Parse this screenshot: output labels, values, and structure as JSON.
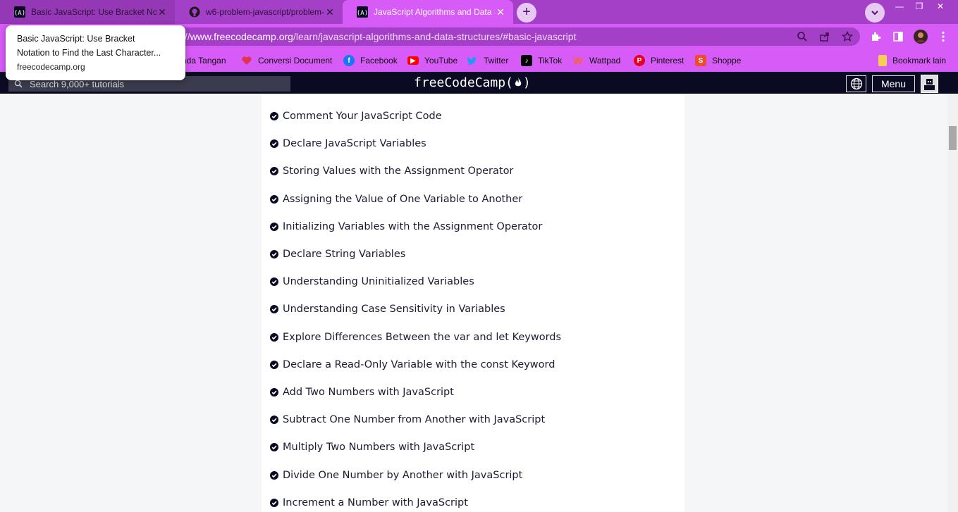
{
  "browser": {
    "tabs": [
      {
        "title": "Basic JavaScript: Use Bracket Not",
        "icon": "freecodecamp-icon"
      },
      {
        "title": "w6-problem-javascript/problem-",
        "icon": "github-icon"
      },
      {
        "title": "JavaScript Algorithms and Data S",
        "icon": "freecodecamp-icon"
      }
    ],
    "url_prefix": "://",
    "url_host": "www.freecodecamp.org",
    "url_path": "/learn/javascript-algorithms-and-data-structures/#basic-javascript",
    "hovercard": {
      "title_line1": "Basic JavaScript: Use Bracket",
      "title_line2": "Notation to Find the Last Character...",
      "domain": "freecodecamp.org"
    },
    "bookmarks": [
      {
        "label": "nda Tangan"
      },
      {
        "label": "Conversi Document",
        "color": "#e0344e"
      },
      {
        "label": "Facebook",
        "color": "#1877f2"
      },
      {
        "label": "YouTube",
        "color": "#ff0000"
      },
      {
        "label": "Twitter",
        "color": "#1d9bf0"
      },
      {
        "label": "TikTok",
        "color": "#000000"
      },
      {
        "label": "Wattpad",
        "color": "#ff6122"
      },
      {
        "label": "Pinterest",
        "color": "#e60023"
      },
      {
        "label": "Shoppe",
        "color": "#ee4d2d"
      }
    ],
    "other_bookmarks": "Bookmark lain"
  },
  "fcc": {
    "search_placeholder": "Search 9,000+ tutorials",
    "brand": "freeCodeCamp(",
    "brand_close": ")",
    "menu_label": "Menu"
  },
  "lessons": [
    "Comment Your JavaScript Code",
    "Declare JavaScript Variables",
    "Storing Values with the Assignment Operator",
    "Assigning the Value of One Variable to Another",
    "Initializing Variables with the Assignment Operator",
    "Declare String Variables",
    "Understanding Uninitialized Variables",
    "Understanding Case Sensitivity in Variables",
    "Explore Differences Between the var and let Keywords",
    "Declare a Read-Only Variable with the const Keyword",
    "Add Two Numbers with JavaScript",
    "Subtract One Number from Another with JavaScript",
    "Multiply Two Numbers with JavaScript",
    "Divide One Number by Another with JavaScript",
    "Increment a Number with JavaScript"
  ],
  "colors": {
    "tab_strip": "#a43fc7",
    "active_tab": "#d65bf7",
    "fcc_nav": "#0a0a23"
  }
}
